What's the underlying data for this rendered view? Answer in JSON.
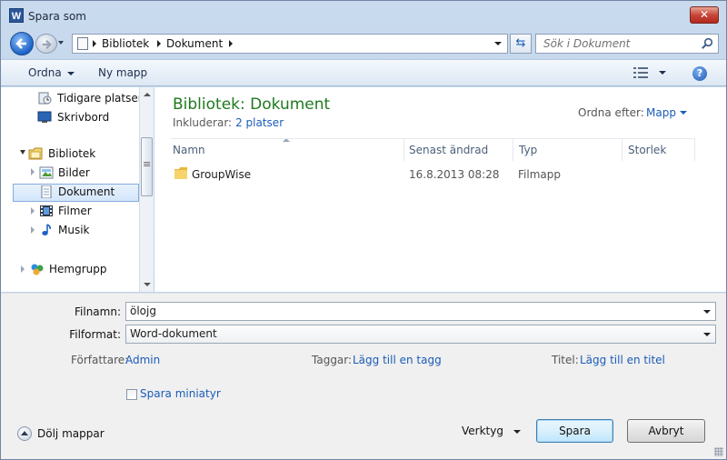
{
  "window": {
    "title": "Spara som",
    "app_icon_letter": "W",
    "close_glyph": "✕"
  },
  "address": {
    "crumbs": [
      "Bibliotek",
      "Dokument"
    ],
    "search_placeholder": "Sök i Dokument"
  },
  "toolbar": {
    "organize_label": "Ordna",
    "new_folder_label": "Ny mapp",
    "help_glyph": "?"
  },
  "nav": {
    "items": [
      {
        "label": "Tidigare platser",
        "icon": "recent-places-icon"
      },
      {
        "label": "Skrivbord",
        "icon": "desktop-icon"
      },
      {
        "label": "Bibliotek",
        "icon": "libraries-icon"
      },
      {
        "label": "Bilder",
        "icon": "pictures-icon"
      },
      {
        "label": "Dokument",
        "icon": "documents-icon",
        "selected": true
      },
      {
        "label": "Filmer",
        "icon": "videos-icon"
      },
      {
        "label": "Musik",
        "icon": "music-icon"
      },
      {
        "label": "Hemgrupp",
        "icon": "homegroup-icon"
      }
    ]
  },
  "library": {
    "title": "Bibliotek: Dokument",
    "includes_label": "Inkluderar:",
    "includes_link": "2 platser",
    "arrange_label": "Ordna efter:",
    "arrange_value": "Mapp"
  },
  "columns": [
    "Namn",
    "Senast ändrad",
    "Typ",
    "Storlek"
  ],
  "files": [
    {
      "name": "GroupWise",
      "modified": "16.8.2013 08:28",
      "type": "Filmapp",
      "size": ""
    }
  ],
  "form": {
    "filename_label": "Filnamn:",
    "filename_value": "ölojg",
    "format_label": "Filformat:",
    "format_value": "Word-dokument",
    "author_label": "Författare:",
    "author_value": "Admin",
    "tags_label": "Taggar:",
    "tags_value": "Lägg till en tagg",
    "title_label": "Titel:",
    "title_value": "Lägg till en titel",
    "thumbnail_label": "Spara miniatyr"
  },
  "footer": {
    "hide_folders_label": "Dölj mappar",
    "tools_label": "Verktyg",
    "save_label": "Spara",
    "cancel_label": "Avbryt"
  },
  "colors": {
    "library_title": "#1e7a1e",
    "link": "#1b5cb8",
    "selection_border": "#84acdd"
  }
}
